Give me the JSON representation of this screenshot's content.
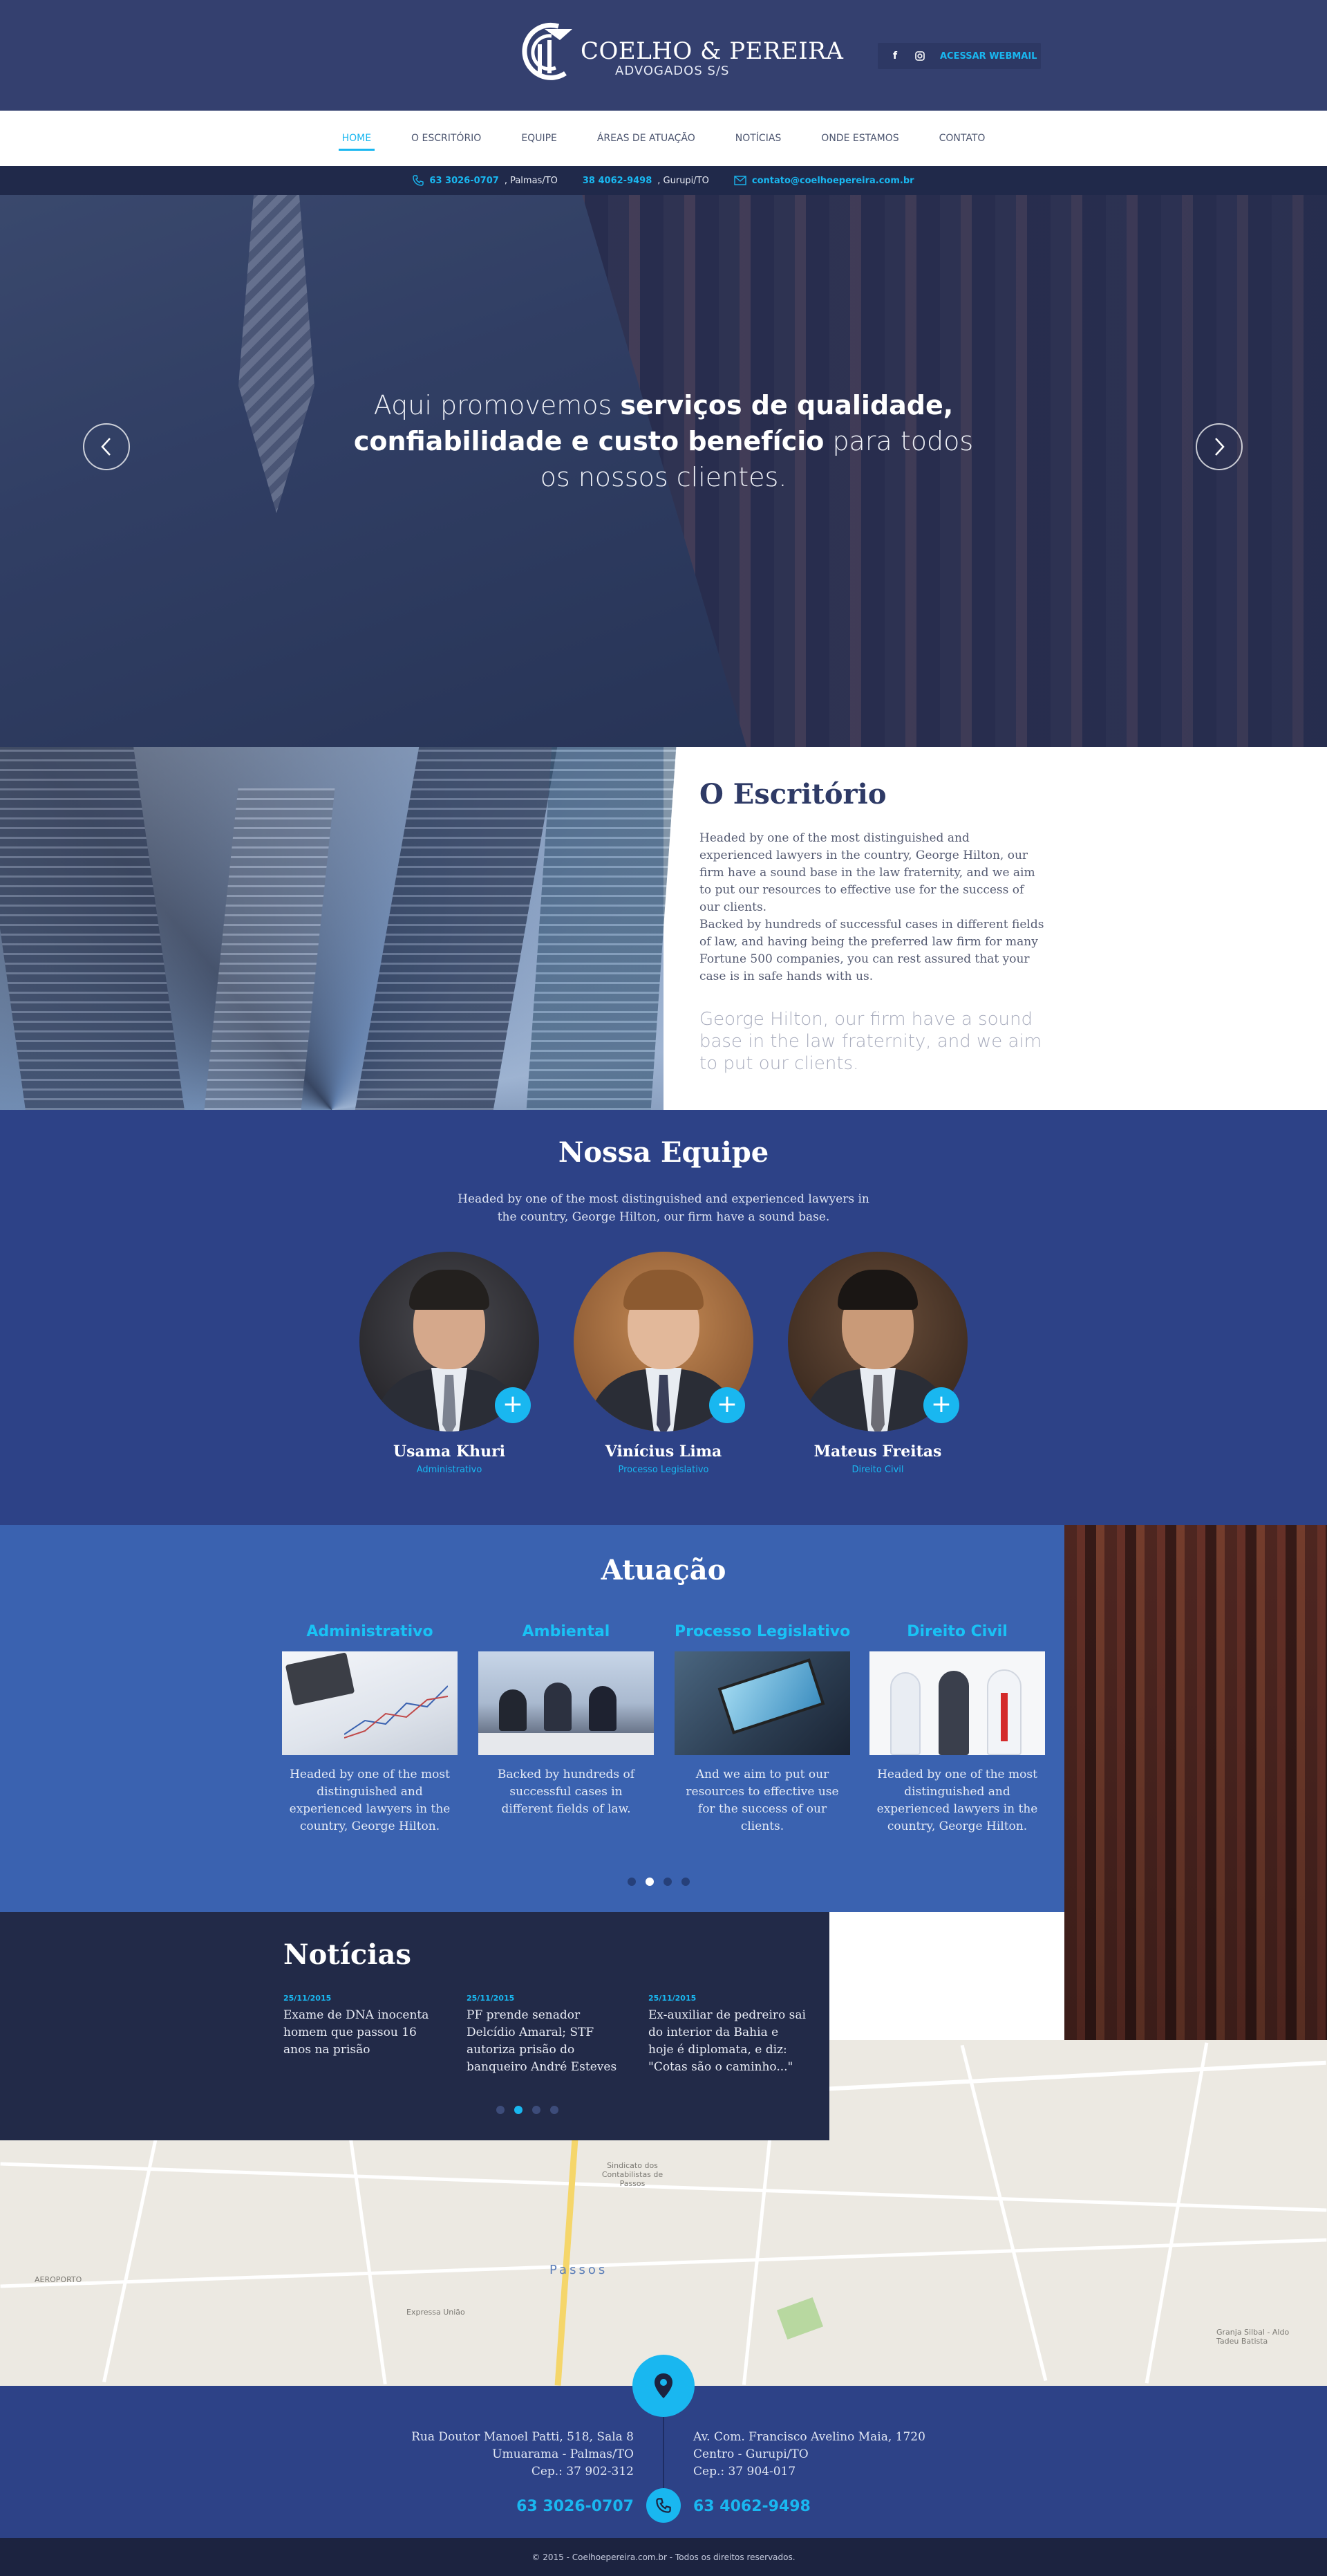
{
  "brand": {
    "name": "COELHO & PEREIRA",
    "subtitle": "ADVOGADOS S/S",
    "accent": "#19b7f0",
    "navy": "#34406f"
  },
  "header": {
    "facebook_icon": "f",
    "instagram_icon": "instagram-icon",
    "webmail_label": "ACESSAR WEBMAIL"
  },
  "nav": {
    "items": [
      {
        "label": "HOME",
        "active": true
      },
      {
        "label": "O ESCRITÓRIO"
      },
      {
        "label": "EQUIPE"
      },
      {
        "label": "ÁREAS DE ATUAÇÃO"
      },
      {
        "label": "NOTÍCIAS"
      },
      {
        "label": "ONDE ESTAMOS"
      },
      {
        "label": "CONTATO"
      }
    ]
  },
  "contact_bar": {
    "phone1": "63 3026-0707",
    "city1": ", Palmas/TO",
    "phone2": "38 4062-9498",
    "city2": ", Gurupi/TO",
    "email": "contato@coelhoepereira.com.br"
  },
  "hero": {
    "text_a": "Aqui promovemos ",
    "text_b": "serviços de qualidade, confiabilidade e custo benefício",
    "text_c": " para todos os nossos clientes."
  },
  "escritorio": {
    "title": "O Escritório",
    "p1": "Headed by one of the most distinguished and experienced lawyers in the country, George Hilton, our firm have a sound base in the law fraternity, and we aim to put our resources to effective use for the success of our clients.",
    "p2": "Backed by hundreds of successful cases in different fields of law, and having being the preferred law firm for many Fortune 500 companies, you can rest assured that your case is in safe hands with us.",
    "quote": "George Hilton, our firm have a sound base in the law fraternity, and we aim to put our clients."
  },
  "equipe": {
    "title": "Nossa Equipe",
    "subtitle": "Headed by one of the most distinguished and experienced lawyers in the country, George Hilton, our firm have a sound base.",
    "members": [
      {
        "name": "Usama Khuri",
        "role": "Administrativo"
      },
      {
        "name": "Vinícius Lima",
        "role": "Processo Legislativo"
      },
      {
        "name": "Mateus Freitas",
        "role": "Direito Civil"
      }
    ]
  },
  "atuacao": {
    "title": "Atuação",
    "cards": [
      {
        "title": "Administrativo",
        "text": "Headed by one of the most distinguished and experienced lawyers in the country, George Hilton."
      },
      {
        "title": "Ambiental",
        "text": "Backed by hundreds of successful cases in different fields of law."
      },
      {
        "title": "Processo Legislativo",
        "text": "And we aim to put our resources to effective use for the success of our clients."
      },
      {
        "title": "Direito Civil",
        "text": "Headed by one of the most distinguished and experienced lawyers in the country, George Hilton."
      }
    ],
    "active_dot": 1
  },
  "noticias": {
    "title": "Notícias",
    "items": [
      {
        "date": "25/11/2015",
        "text": "Exame de DNA inocenta homem que passou 16 anos na prisão"
      },
      {
        "date": "25/11/2015",
        "text": "PF prende senador Delcídio Amaral; STF autoriza prisão do banqueiro André Esteves"
      },
      {
        "date": "25/11/2015",
        "text": "Ex-auxiliar de pedreiro sai do interior da Bahia e hoje é diplomata, e diz: \"Cotas são o caminho...\""
      }
    ],
    "active_dot": 1
  },
  "map": {
    "city": "Passos",
    "labels": [
      "AEROPORTO",
      "Sindicato dos Contabilistas de Passos",
      "Granja Silbal - Aldo Tadeu Batista",
      "Expressa União"
    ]
  },
  "footer": {
    "left_address": [
      "Rua Doutor Manoel Patti, 518, Sala 8",
      "Umuarama - Palmas/TO",
      "Cep.: 37 902-312"
    ],
    "right_address": [
      "Av. Com. Francisco Avelino Maia, 1720",
      "Centro - Gurupi/TO",
      "Cep.: 37 904-017"
    ],
    "phone_left": "63 3026-0707",
    "phone_right": "63 4062-9498",
    "copyright": "© 2015 - Coelhoepereira.com.br - Todos os direitos reservados."
  }
}
